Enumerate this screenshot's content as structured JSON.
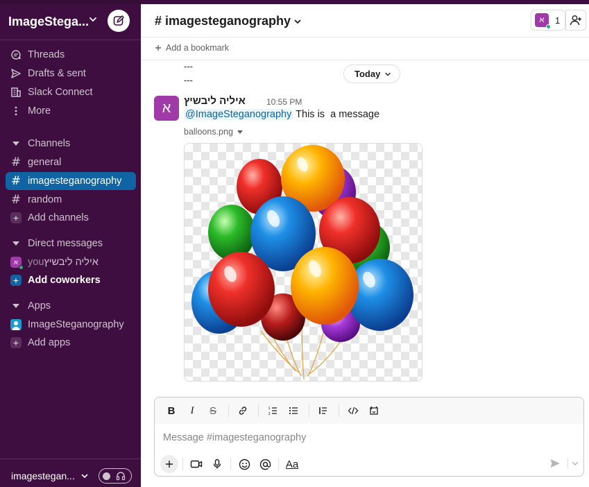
{
  "workspace": {
    "name": "ImageStega...",
    "bottom_name": "imagestegan..."
  },
  "sidebar": {
    "nav": [
      {
        "label": "Threads",
        "icon": "threads-icon"
      },
      {
        "label": "Drafts & sent",
        "icon": "send-icon"
      },
      {
        "label": "Slack Connect",
        "icon": "building-icon"
      },
      {
        "label": "More",
        "icon": "more-vertical-icon"
      }
    ],
    "channels_header": "Channels",
    "channels": [
      {
        "label": "general"
      },
      {
        "label": "imagesteganography",
        "active": true
      },
      {
        "label": "random"
      }
    ],
    "add_channels": "Add channels",
    "dm_header": "Direct messages",
    "dm_user": {
      "name": "איליה ליבשיץ",
      "you": "you",
      "avatar_letter": "א"
    },
    "add_coworkers": "Add coworkers",
    "apps_header": "Apps",
    "apps": [
      {
        "label": "ImageSteganography"
      }
    ],
    "add_apps": "Add apps"
  },
  "header": {
    "channel_title": "# imagesteganography",
    "member_count": "1",
    "avatar_letter": "א",
    "bookmark_label": "Add a bookmark"
  },
  "messages": {
    "dash_lines": [
      "---",
      "---"
    ],
    "date_divider": "Today",
    "author": "איליה ליבשיץ",
    "avatar_letter": "א",
    "time": "10:55 PM",
    "mention": "@ImageSteganography",
    "text": " This is  a message",
    "file_name": "balloons.png"
  },
  "composer": {
    "placeholder": "Message #imagesteganography",
    "format_buttons": [
      "bold",
      "italic",
      "strikethrough",
      "link",
      "ordered-list",
      "bulleted-list",
      "blockquote",
      "code",
      "code-block"
    ],
    "aa_label": "Aa"
  },
  "colors": {
    "sidebar_bg": "#3f0e40",
    "active_item": "#1164a3",
    "mention_bg": "#e8f5fa",
    "mention_text": "#1264a3",
    "avatar_purple": "#a03aa8",
    "presence": "#2bac76"
  }
}
